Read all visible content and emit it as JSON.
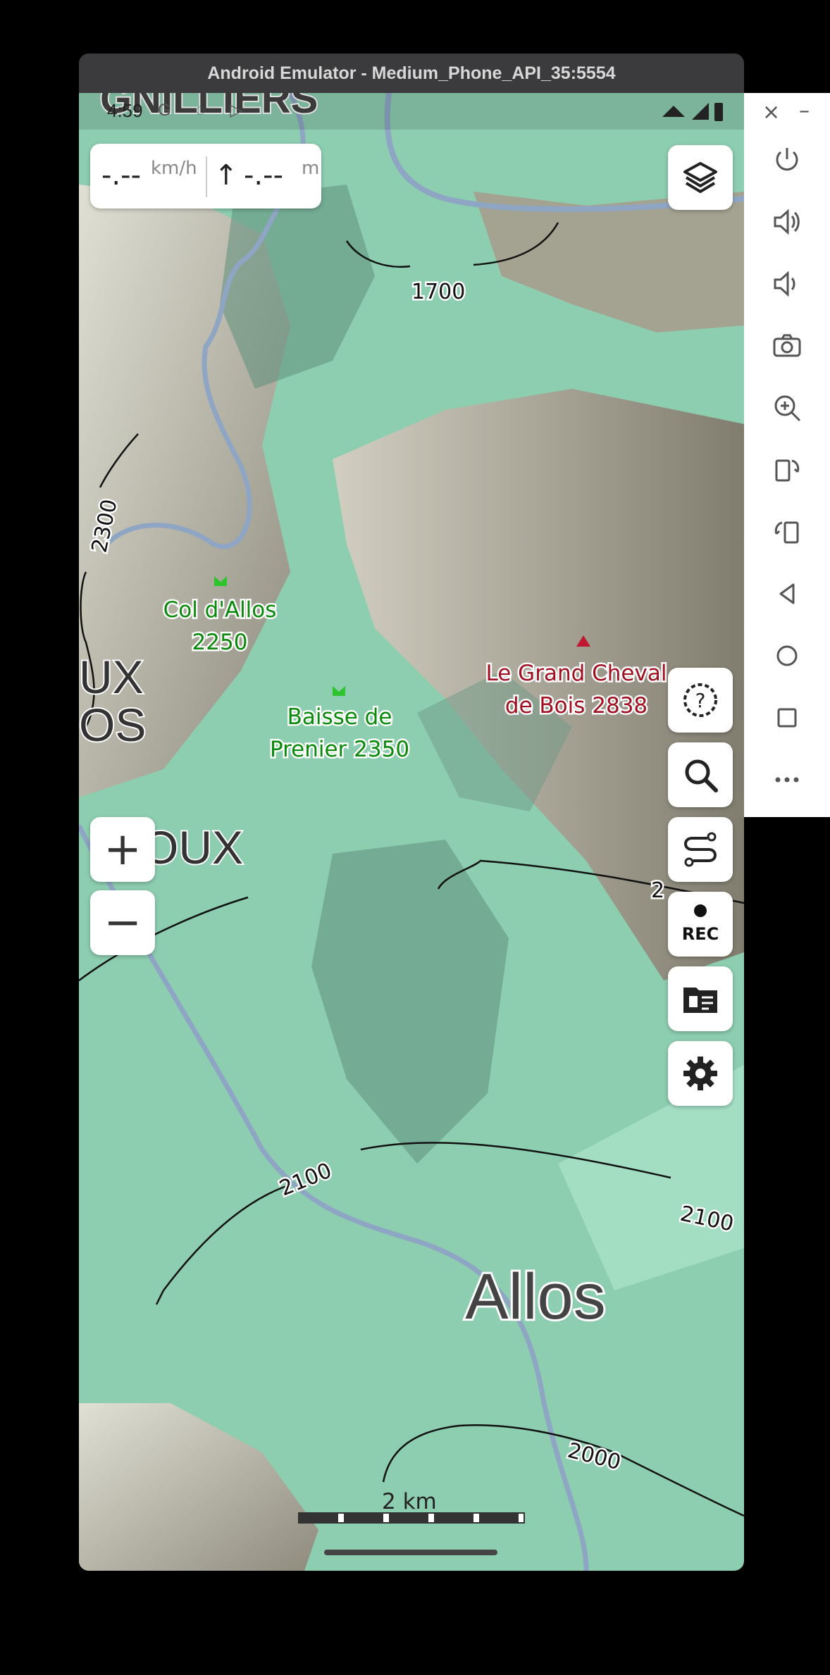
{
  "window": {
    "title": "Android Emulator - Medium_Phone_API_35:5554"
  },
  "status_bar": {
    "time": "4:59",
    "icons": [
      "G",
      "shield",
      "play"
    ]
  },
  "speed_panel": {
    "speed": "-.--",
    "speed_unit": "km/h",
    "altitude": "-.--",
    "altitude_unit": "m",
    "arrow": "↑"
  },
  "map": {
    "places": [
      {
        "name": "Col d'Allos",
        "value": "2250"
      },
      {
        "name": "Baisse de",
        "name2": "Prenier 2350"
      },
      {
        "name": "Le Grand Cheval",
        "name2": "de Bois 2838"
      },
      {
        "name": "Allos"
      }
    ],
    "partial_labels": [
      "GNILLIERS",
      "UX",
      "OS",
      "OUX"
    ],
    "contours": [
      "1700",
      "2300",
      "2100",
      "2100",
      "2000",
      "2"
    ],
    "scale": "2 km"
  },
  "buttons": {
    "layers": "layers-icon",
    "help": "help-icon",
    "search": "search-icon",
    "route": "route-icon",
    "rec": "REC",
    "tracks": "tracks-icon",
    "settings": "gear-icon",
    "zoom_in": "+",
    "zoom_out": "−"
  },
  "emulator_controls": {
    "close": "×",
    "minimize": "–",
    "items": [
      "power-icon",
      "volume-up-icon",
      "volume-down-icon",
      "camera-icon",
      "zoom-icon",
      "rotate-left-icon",
      "rotate-right-icon",
      "back-icon",
      "home-icon",
      "overview-icon",
      "more-icon"
    ]
  },
  "colors": {
    "forest": "#8fd6b8",
    "rock": "#c6b8a8",
    "place_green": "#0a8a0a",
    "place_red": "#a01020"
  }
}
